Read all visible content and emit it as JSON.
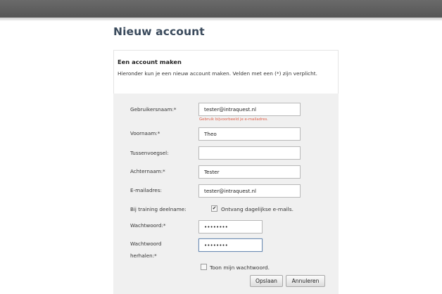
{
  "page": {
    "title": "Nieuw account"
  },
  "intro": {
    "heading": "Een account maken",
    "description": "Hieronder kun je een nieuw account maken. Velden met een (*) zijn verplicht."
  },
  "form": {
    "username": {
      "label": "Gebruikersnaam:*",
      "value": "tester@intraquest.nl",
      "hint": "Gebruik bijvoorbeeld je e-mailadres."
    },
    "firstname": {
      "label": "Voornaam:*",
      "value": "Theo"
    },
    "infix": {
      "label": "Tussenvoegsel:",
      "value": ""
    },
    "lastname": {
      "label": "Achternaam:*",
      "value": "Tester"
    },
    "email": {
      "label": "E-mailadres:",
      "value": "tester@intraquest.nl"
    },
    "training": {
      "label": "Bij training deelname:",
      "checkbox_label": "Ontvang dagelijkse e-mails.",
      "checked": true
    },
    "password": {
      "label": "Wachtwoord:*",
      "value": "••••••••"
    },
    "password_repeat": {
      "label_line1": "Wachtwoord",
      "label_line2": "herhalen:*",
      "value": "••••••••"
    },
    "show_password": {
      "label": "Toon mijn wachtwoord.",
      "checked": false
    }
  },
  "buttons": {
    "save": "Opslaan",
    "cancel": "Annuleren"
  },
  "colors": {
    "title": "#3a4a5c",
    "hint": "#e0614a",
    "topbar": "#5f5f5f",
    "panel": "#f0f0f0",
    "focus_border": "#6e8db3"
  }
}
